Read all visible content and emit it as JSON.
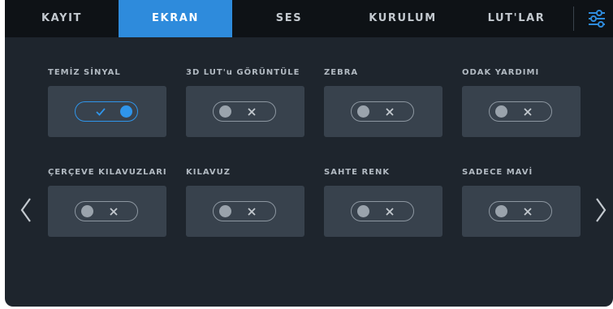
{
  "tabs": [
    {
      "label": "KAYIT",
      "active": false
    },
    {
      "label": "EKRAN",
      "active": true
    },
    {
      "label": "SES",
      "active": false
    },
    {
      "label": "KURULUM",
      "active": false
    },
    {
      "label": "LUT'LAR",
      "active": false
    }
  ],
  "settings_icon": "sliders-icon",
  "toggles": [
    {
      "label": "TEMİZ SİNYAL",
      "state": "on"
    },
    {
      "label": "3D LUT'u GÖRÜNTÜLE",
      "state": "off"
    },
    {
      "label": "ZEBRA",
      "state": "off"
    },
    {
      "label": "ODAK YARDIMI",
      "state": "off"
    },
    {
      "label": "ÇERÇEVE KILAVUZLARI",
      "state": "off"
    },
    {
      "label": "KILAVUZ",
      "state": "off"
    },
    {
      "label": "SAHTE RENK",
      "state": "off"
    },
    {
      "label": "SADECE MAVİ",
      "state": "off"
    }
  ],
  "nav": {
    "prev_icon": "chevron-left-icon",
    "next_icon": "chevron-right-icon"
  },
  "colors": {
    "accent": "#2e8bdc",
    "background": "#1e252d",
    "tab_bar": "#0e1216",
    "card": "#38424d"
  }
}
